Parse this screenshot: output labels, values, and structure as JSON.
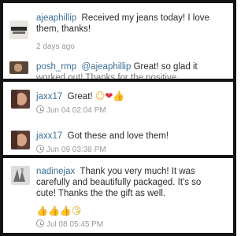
{
  "comments": [
    {
      "username": "ajeaphillip",
      "text_line1": "Received my jeans today! I love",
      "text_line2": "them, thanks!",
      "time": "2 days ago"
    },
    {
      "username": "posh_rmp",
      "mention": "@ajeaphillip",
      "text_line1": "Great! so glad it",
      "text_line2_cut": "worked out! Thanks for the positive"
    },
    {
      "username": "jaxx17",
      "text": "Great!",
      "emojis": [
        "smile-emoji",
        "heart-emoji",
        "thumbs-up-emoji"
      ],
      "time": "Jun 04 02:04 PM"
    },
    {
      "username": "jaxx17",
      "text": "Got these and love them!",
      "time": "Jun 09 03:38 PM"
    },
    {
      "username": "nadinejax",
      "text_line1": "Thank you very much! It was",
      "text_line2": "carefully and beautifully packaged.  It's so",
      "text_line3": "cute!  Thanks the the gift as well.",
      "emojis": [
        "thumbs-up-emoji",
        "thumbs-up-emoji",
        "thumbs-up-emoji",
        "kiss-emoji"
      ],
      "time": "Jul 08 05:45 PM"
    }
  ],
  "colors": {
    "username": "#3a6f98",
    "text": "#2a2a2a",
    "timestamp": "#9a9a9a",
    "frame": "#141414"
  }
}
